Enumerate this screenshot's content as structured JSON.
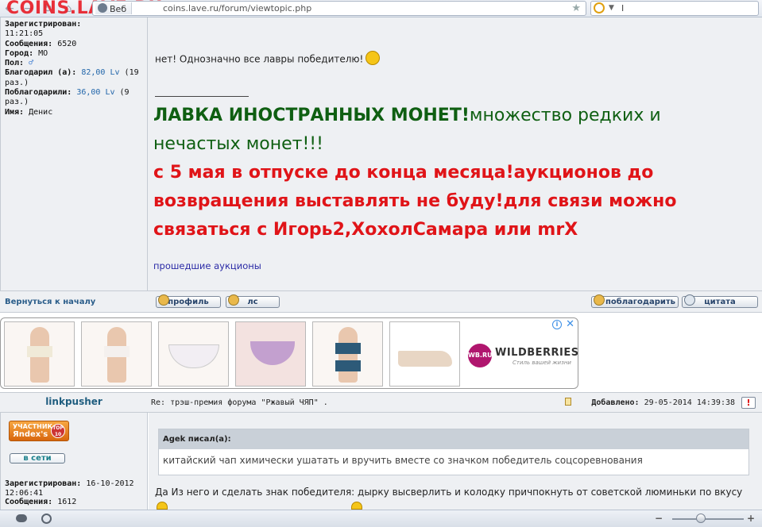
{
  "browser": {
    "site_label": "COINS.LAVE.RU",
    "url_badge": "Веб",
    "url": "coins.lave.ru/forum/viewtopic.php",
    "search_value": "I"
  },
  "post1": {
    "info": [
      {
        "label": "Зарегистрирован:",
        "value": ""
      },
      {
        "label": "",
        "value": "11:21:05"
      },
      {
        "label": "Сообщения:",
        "value": "6520"
      },
      {
        "label": "Город:",
        "value": "МО"
      },
      {
        "label": "Пол:",
        "value": "♂"
      },
      {
        "label": "Благодарил (а):",
        "value": "82,00 Lv",
        "suffix": "(19 раз.)"
      },
      {
        "label": "Поблагодарили:",
        "value": "36,00 Lv",
        "suffix": "(9 раз.)"
      },
      {
        "label": "Имя:",
        "value": "Денис"
      }
    ],
    "reply_text": "нет! Однозначно все лавры победителю!",
    "sig_green_bold": "ЛАВКА ИНОСТРАННЫХ МОНЕТ!",
    "sig_green_rest": "множество редких и нечастых монет!!!",
    "sig_red": "с 5 мая в отпуске до конца месяца!аукционов до возвращения выставлять не буду!для связи можно связаться с Игорь2,ХохолСамара или mrX",
    "sig_link": "прошедшие аукционы",
    "back_to_top": "Вернуться к началу",
    "btn_profile": "профиль",
    "btn_pm": "лс",
    "btn_thank": "поблагодарить",
    "btn_quote": "цитата"
  },
  "ad": {
    "brand_short": "WB.RU",
    "brand": "WILDBERRIES",
    "tagline": "Стиль вашей жизни",
    "info": "i",
    "close": "✕"
  },
  "post2": {
    "author": "linkpusher",
    "subject": "Re: трэш-премия форума \"Ржавый ЧЯП\" .",
    "added_label": "Добавлено:",
    "added_value": "29-05-2014 14:39:38",
    "report": "!",
    "rank_line1": "УЧАСТНИК",
    "rank_line2": "Яndex's",
    "rank_top": "TOP 10",
    "online": "в сети",
    "registered_label": "Зарегистрирован:",
    "registered_date": "16-10-2012",
    "registered_time": "12:06:41",
    "messages_label": "Сообщения:",
    "messages_value": "1612",
    "quote_author": "Agek писал(а):",
    "quote_text": "китайский чап химически ушатать и вручить вместе со значком победитель соцсоревнования",
    "text": "Да Из него и сделать знак победителя: дырку высверлить и колодку причпокнуть от советской люминьки по вкусу"
  },
  "statusbar": {
    "zoom_minus": "−",
    "zoom_plus": "+",
    "zoom_level": 0.4
  }
}
